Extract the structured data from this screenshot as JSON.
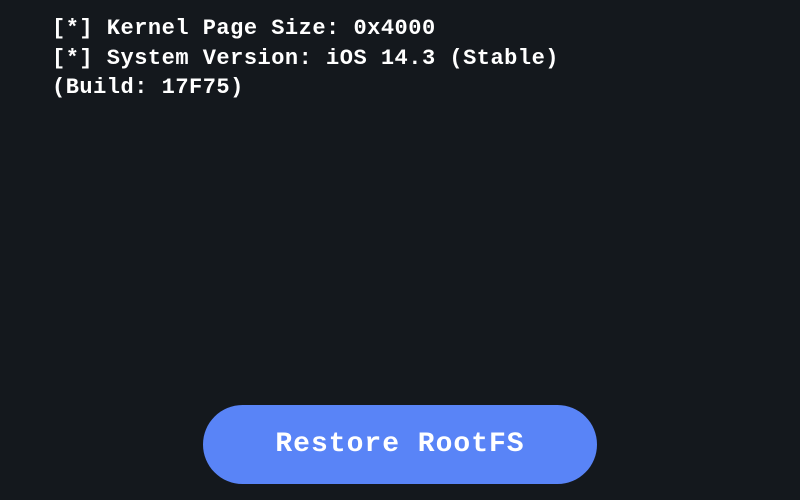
{
  "log": {
    "lines": [
      "[*] Kernel Page Size: 0x4000",
      "[*] System Version: iOS 14.3 (Stable)",
      "(Build: 17F75)"
    ]
  },
  "actions": {
    "restore_label": "Restore RootFS"
  },
  "colors": {
    "background": "#14181d",
    "text": "#ffffff",
    "button_bg": "#5984f7"
  }
}
